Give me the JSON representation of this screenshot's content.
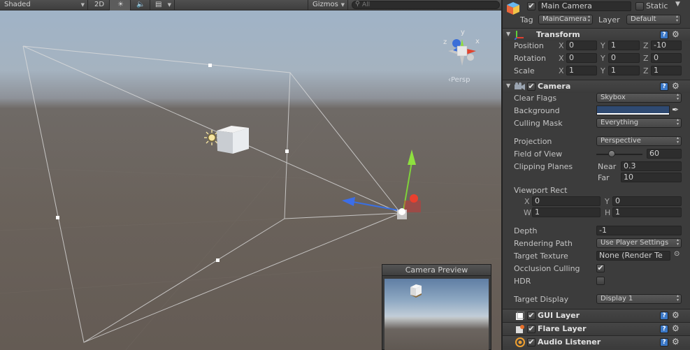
{
  "scene_toolbar": {
    "shading_mode": "Shaded",
    "mode_2d": "2D",
    "lighting_icon": "sun-icon",
    "audio_icon": "speaker-icon",
    "effects_icon": "image-icon",
    "gizmos": "Gizmos",
    "search_placeholder": "All"
  },
  "scene": {
    "persp_label": "‹Persp",
    "gizmo_axes": {
      "y": "y",
      "x": "x",
      "z": "z"
    }
  },
  "camera_preview": {
    "title": "Camera Preview"
  },
  "inspector": {
    "object_name": "Main Camera",
    "static_label": "Static",
    "tag_label": "Tag",
    "tag_value": "MainCamera",
    "layer_label": "Layer",
    "layer_value": "Default",
    "transform": {
      "title": "Transform",
      "position": {
        "label": "Position",
        "x": "0",
        "y": "1",
        "z": "-10"
      },
      "rotation": {
        "label": "Rotation",
        "x": "0",
        "y": "0",
        "z": "0"
      },
      "scale": {
        "label": "Scale",
        "x": "1",
        "y": "1",
        "z": "1"
      },
      "axis_x": "X",
      "axis_y": "Y",
      "axis_z": "Z"
    },
    "camera": {
      "title": "Camera",
      "clear_flags_label": "Clear Flags",
      "clear_flags_value": "Skybox",
      "background_label": "Background",
      "background_color": "#2f4a72",
      "culling_mask_label": "Culling Mask",
      "culling_mask_value": "Everything",
      "projection_label": "Projection",
      "projection_value": "Perspective",
      "fov_label": "Field of View",
      "fov_value": "60",
      "fov_slider_fraction": 0.33,
      "clipping_label": "Clipping Planes",
      "near_label": "Near",
      "near_value": "0.3",
      "far_label": "Far",
      "far_value": "10",
      "viewport_label": "Viewport Rect",
      "vp_x_label": "X",
      "vp_x": "0",
      "vp_y_label": "Y",
      "vp_y": "0",
      "vp_w_label": "W",
      "vp_w": "1",
      "vp_h_label": "H",
      "vp_h": "1",
      "depth_label": "Depth",
      "depth_value": "-1",
      "rendering_path_label": "Rendering Path",
      "rendering_path_value": "Use Player Settings",
      "target_texture_label": "Target Texture",
      "target_texture_value": "None (Render Te",
      "occlusion_label": "Occlusion Culling",
      "occlusion_checked": true,
      "hdr_label": "HDR",
      "hdr_checked": false,
      "target_display_label": "Target Display",
      "target_display_value": "Display 1"
    },
    "components": [
      {
        "title": "GUI Layer",
        "icon": "gui-layer-icon"
      },
      {
        "title": "Flare Layer",
        "icon": "flare-layer-icon"
      },
      {
        "title": "Audio Listener",
        "icon": "audio-listener-icon"
      }
    ],
    "check_glyph": "✔",
    "help_glyph": "?",
    "gear_glyph": "⚙"
  }
}
